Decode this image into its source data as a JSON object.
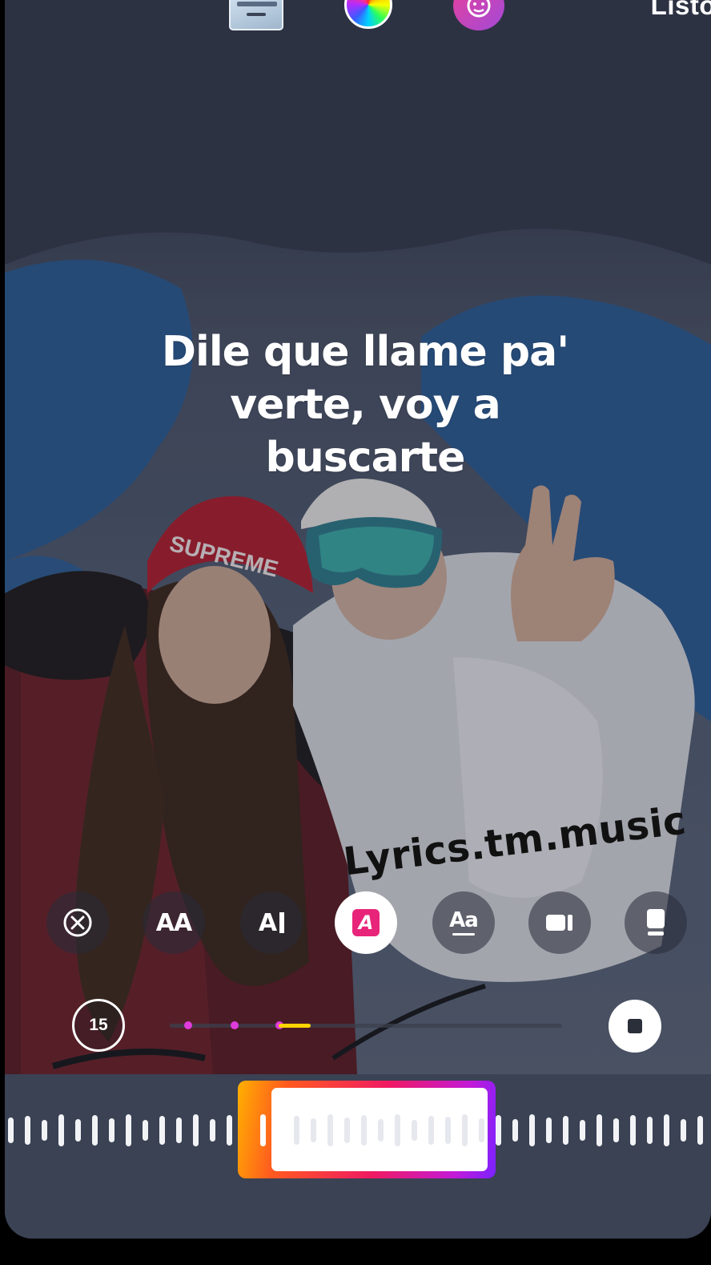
{
  "top_bar": {
    "done_label": "Listo",
    "thumbnail_icon": "album-cover-thumbnail",
    "color_picker_icon": "color-wheel-icon",
    "face_sticker_icon": "face-sticker-icon"
  },
  "lyric": {
    "text": "Dile que llame pa' verte, voy a buscarte"
  },
  "watermark": {
    "text": "Lyrics.tm.music"
  },
  "style_tools": [
    {
      "name": "remove-style",
      "icon": "close-circle-icon"
    },
    {
      "name": "text-style-large",
      "icon": "aa-large-icon",
      "label": "AA"
    },
    {
      "name": "text-style-cursor",
      "icon": "a-cursor-icon",
      "label": "A"
    },
    {
      "name": "text-style-highlight",
      "icon": "a-highlight-icon",
      "label": "A",
      "active": true
    },
    {
      "name": "text-style-underline",
      "icon": "aa-underline-icon",
      "label": "Aa"
    },
    {
      "name": "layout-video",
      "icon": "video-card-icon"
    },
    {
      "name": "layout-card",
      "icon": "card-icon"
    }
  ],
  "playback": {
    "timer_label": "15",
    "progress_fraction": 0.36,
    "colors": {
      "progress": "#ffd400",
      "markers": "#e03bdb"
    }
  },
  "scrubber": {
    "colors": {
      "gradient_start": "#ffb000",
      "gradient_end": "#7b22ff"
    }
  }
}
